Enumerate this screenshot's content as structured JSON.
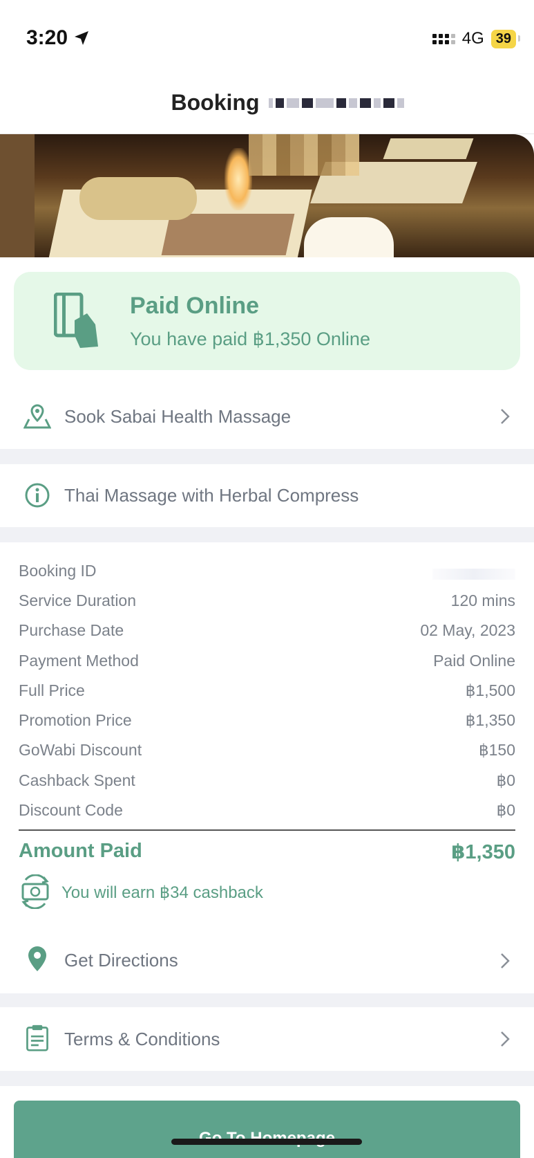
{
  "status_bar": {
    "time": "3:20",
    "network": "4G",
    "battery": "39"
  },
  "header": {
    "title": "Booking"
  },
  "payment": {
    "title": "Paid Online",
    "subtitle": "You have paid ฿1,350 Online"
  },
  "venue": {
    "label": "Sook Sabai Health Massage"
  },
  "service": {
    "label": "Thai Massage with Herbal Compress"
  },
  "details": [
    {
      "key": "Booking ID",
      "value": ""
    },
    {
      "key": "Service Duration",
      "value": "120 mins"
    },
    {
      "key": "Purchase Date",
      "value": "02 May, 2023"
    },
    {
      "key": "Payment Method",
      "value": "Paid Online"
    },
    {
      "key": "Full Price",
      "value": "฿1,500"
    },
    {
      "key": "Promotion Price",
      "value": "฿1,350"
    },
    {
      "key": "GoWabi Discount",
      "value": "฿150"
    },
    {
      "key": "Cashback Spent",
      "value": "฿0"
    },
    {
      "key": "Discount Code",
      "value": "฿0"
    }
  ],
  "amount_paid": {
    "label": "Amount Paid",
    "value": "฿1,350"
  },
  "cashback": {
    "text": "You will earn ฿34 cashback"
  },
  "directions": {
    "label": "Get Directions"
  },
  "terms": {
    "label": "Terms & Conditions"
  },
  "home_button": {
    "label": "Go To Homepage"
  },
  "colors": {
    "accent": "#5a9e84",
    "button": "#5ea38c",
    "paid_card_bg": "#e5f8e8"
  }
}
